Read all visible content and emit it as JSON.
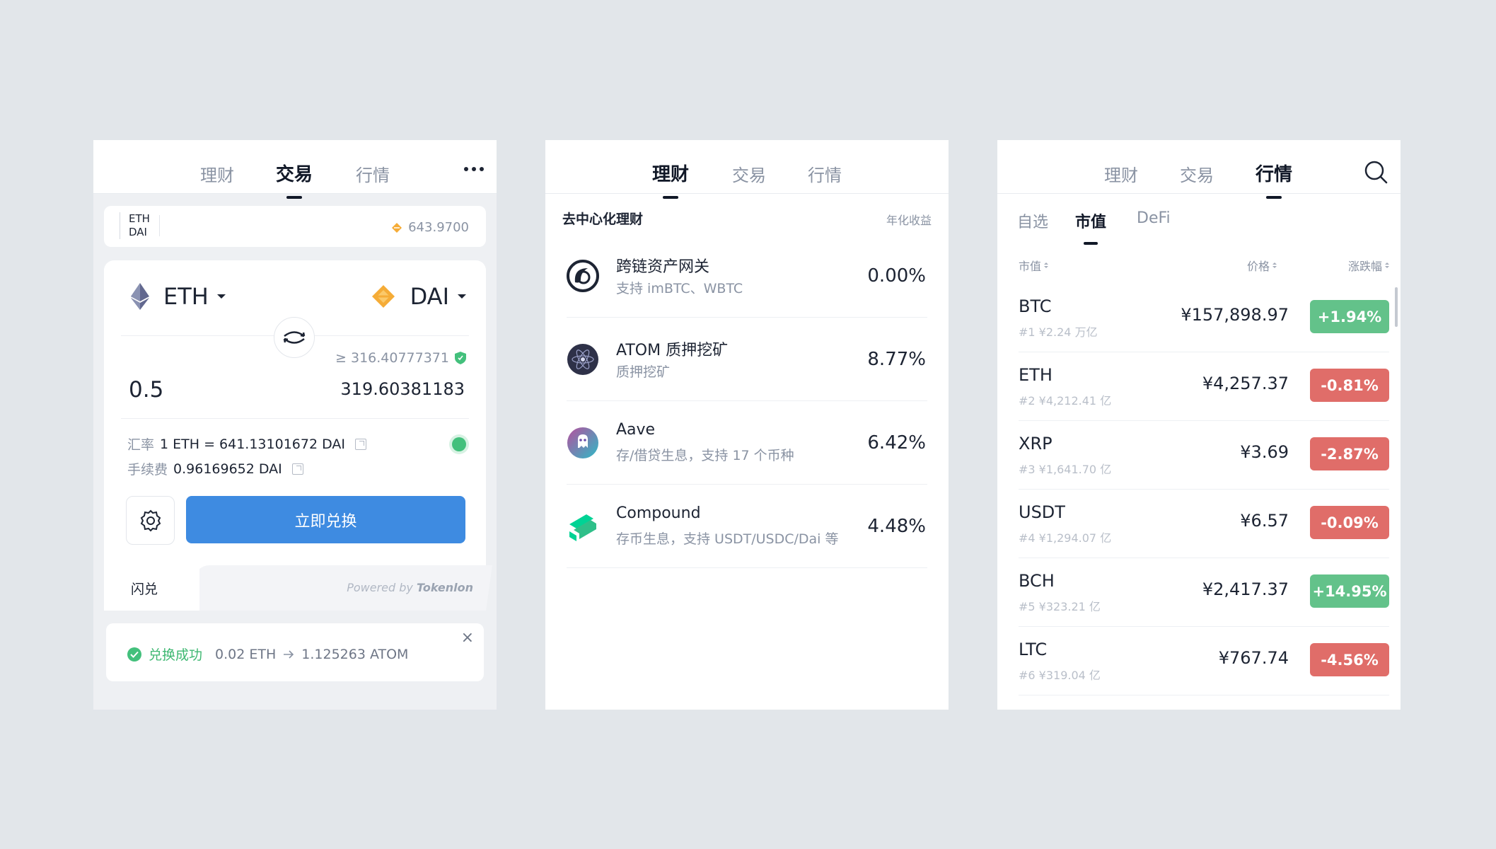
{
  "colors": {
    "accent": "#3e8be1",
    "up": "#63c28a",
    "down": "#e06d69",
    "success": "#43c07c"
  },
  "panel_trade": {
    "tabs": [
      "理财",
      "交易",
      "行情"
    ],
    "active_tab": 1,
    "pair_bar": {
      "base": "ETH",
      "quote": "DAI",
      "price": "643.9700"
    },
    "from_token": "ETH",
    "to_token": "DAI",
    "min_receive": "≥ 316.40777371",
    "amount_in": "0.5",
    "amount_out": "319.60381183",
    "rate_label": "汇率",
    "rate_value": "1 ETH = 641.13101672 DAI",
    "fee_label": "手续费",
    "fee_value": "0.96169652 DAI",
    "swap_button": "立即兑换",
    "footer_tab": "闪兑",
    "powered_by": "Powered by",
    "powered_brand": "Tokenlon",
    "toast": {
      "status": "兑换成功",
      "from": "0.02 ETH",
      "to": "1.125263 ATOM",
      "close": "×"
    }
  },
  "panel_earn": {
    "tabs": [
      "理财",
      "交易",
      "行情"
    ],
    "active_tab": 0,
    "section_title": "去中心化理财",
    "section_right": "年化收益",
    "items": [
      {
        "name": "跨链资产网关",
        "desc": "支持 imBTC、WBTC",
        "rate": "0.00%",
        "logo": "imbtc-icon"
      },
      {
        "name": "ATOM 质押挖矿",
        "desc": "质押挖矿",
        "rate": "8.77%",
        "logo": "cosmos-icon"
      },
      {
        "name": "Aave",
        "desc": "存/借贷生息，支持 17 个币种",
        "rate": "6.42%",
        "logo": "aave-icon"
      },
      {
        "name": "Compound",
        "desc": "存币生息，支持 USDT/USDC/Dai 等",
        "rate": "4.48%",
        "logo": "compound-icon"
      }
    ]
  },
  "panel_market": {
    "tabs": [
      "理财",
      "交易",
      "行情"
    ],
    "active_tab": 2,
    "subtabs": [
      "自选",
      "市值",
      "DeFi"
    ],
    "active_subtab": 1,
    "columns": {
      "cap": "市值",
      "price": "价格",
      "change": "涨跌幅"
    },
    "rows": [
      {
        "symbol": "BTC",
        "cap": "#1  ¥2.24 万亿",
        "price": "¥157,898.97",
        "change": "+1.94%",
        "up": true
      },
      {
        "symbol": "ETH",
        "cap": "#2  ¥4,212.41 亿",
        "price": "¥4,257.37",
        "change": "-0.81%",
        "up": false
      },
      {
        "symbol": "XRP",
        "cap": "#3  ¥1,641.70 亿",
        "price": "¥3.69",
        "change": "-2.87%",
        "up": false
      },
      {
        "symbol": "USDT",
        "cap": "#4  ¥1,294.07 亿",
        "price": "¥6.57",
        "change": "-0.09%",
        "up": false
      },
      {
        "symbol": "BCH",
        "cap": "#5  ¥323.21 亿",
        "price": "¥2,417.37",
        "change": "+14.95%",
        "up": true
      },
      {
        "symbol": "LTC",
        "cap": "#6  ¥319.04 亿",
        "price": "¥767.74",
        "change": "-4.56%",
        "up": false
      }
    ]
  }
}
